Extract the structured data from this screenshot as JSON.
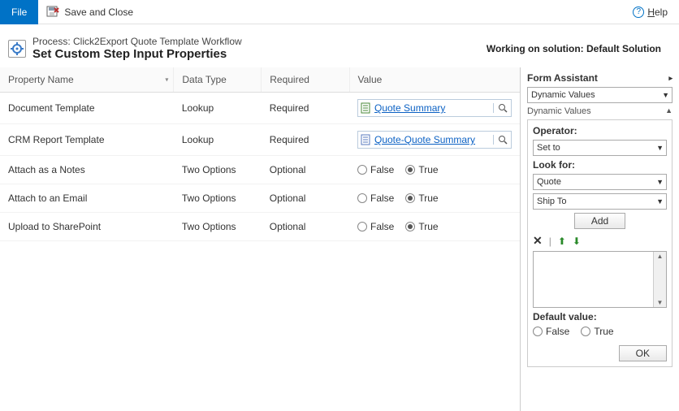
{
  "topbar": {
    "file": "File",
    "saveClose": "Save and Close",
    "help": "Help"
  },
  "header": {
    "processLine": "Process: Click2Export Quote Template Workflow",
    "title": "Set Custom Step Input Properties",
    "workingSolution": "Working on solution: Default Solution"
  },
  "columns": {
    "propName": "Property Name",
    "dataType": "Data Type",
    "required": "Required",
    "value": "Value"
  },
  "rows": [
    {
      "name": "Document Template",
      "dataType": "Lookup",
      "required": "Required",
      "kind": "lookup",
      "value": "Quote Summary",
      "iconColor": "#4a8a3a"
    },
    {
      "name": "CRM Report Template",
      "dataType": "Lookup",
      "required": "Required",
      "kind": "lookup",
      "value": "Quote-Quote Summary",
      "iconColor": "#5a7bbf"
    },
    {
      "name": "Attach as a Notes",
      "dataType": "Two Options",
      "required": "Optional",
      "kind": "bool",
      "falseLabel": "False",
      "trueLabel": "True",
      "selected": "True"
    },
    {
      "name": "Attach to an Email",
      "dataType": "Two Options",
      "required": "Optional",
      "kind": "bool",
      "falseLabel": "False",
      "trueLabel": "True",
      "selected": "True"
    },
    {
      "name": "Upload to SharePoint",
      "dataType": "Two Options",
      "required": "Optional",
      "kind": "bool",
      "falseLabel": "False",
      "trueLabel": "True",
      "selected": "True"
    }
  ],
  "assistant": {
    "title": "Form Assistant",
    "dynValuesDropdown": "Dynamic Values",
    "dynValuesHeader": "Dynamic Values",
    "operatorLabel": "Operator:",
    "operator": "Set to",
    "lookForLabel": "Look for:",
    "lookFor1": "Quote",
    "lookFor2": "Ship To",
    "addBtn": "Add",
    "defaultValueLabel": "Default value:",
    "defFalse": "False",
    "defTrue": "True",
    "defaultSelected": "",
    "okBtn": "OK"
  }
}
